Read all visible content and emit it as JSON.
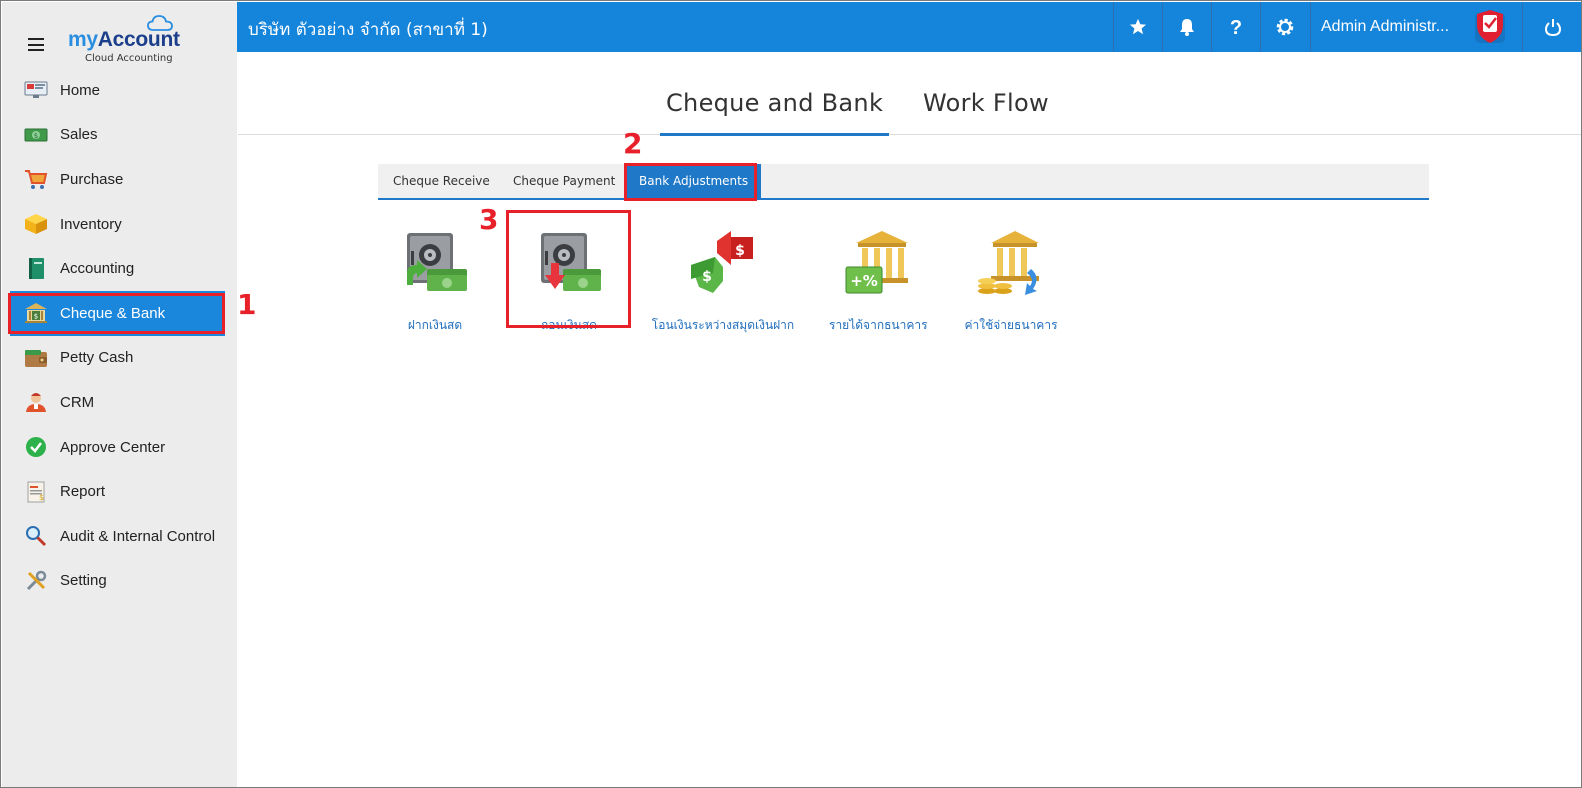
{
  "app": {
    "brand_my": "my",
    "brand_account": "Account",
    "brand_sub": "Cloud Accounting"
  },
  "sidebar": {
    "items": [
      {
        "label": "Home",
        "icon": "home-monitor-icon"
      },
      {
        "label": "Sales",
        "icon": "cash-icon"
      },
      {
        "label": "Purchase",
        "icon": "cart-icon"
      },
      {
        "label": "Inventory",
        "icon": "box-icon"
      },
      {
        "label": "Accounting",
        "icon": "book-icon"
      },
      {
        "label": "Cheque & Bank",
        "icon": "bank-icon"
      },
      {
        "label": "Petty Cash",
        "icon": "wallet-icon"
      },
      {
        "label": "CRM",
        "icon": "people-icon"
      },
      {
        "label": "Approve Center",
        "icon": "check-circle-icon"
      },
      {
        "label": "Report",
        "icon": "report-icon"
      },
      {
        "label": "Audit & Internal Control",
        "icon": "magnifier-icon"
      },
      {
        "label": "Setting",
        "icon": "tools-icon"
      }
    ],
    "active_index": 5
  },
  "topbar": {
    "company": "บริษัท ตัวอย่าง จำกัด (สาขาที่ 1)",
    "user": "Admin Administr...",
    "icons": [
      "star-icon",
      "bell-icon",
      "help-icon",
      "gear-icon",
      "shield-check-icon",
      "power-icon"
    ],
    "background": "#1584db"
  },
  "main_tabs": [
    {
      "label": "Cheque and Bank",
      "active": true
    },
    {
      "label": "Work Flow",
      "active": false
    }
  ],
  "sub_tabs": [
    {
      "label": "Cheque Receive",
      "active": false
    },
    {
      "label": "Cheque Payment",
      "active": false
    },
    {
      "label": "Bank Adjustments",
      "active": true
    }
  ],
  "tiles": [
    {
      "label": "ฝากเงินสด",
      "icon": "safe-deposit-icon"
    },
    {
      "label": "ถอนเงินสด",
      "icon": "safe-withdraw-icon"
    },
    {
      "label": "โอนเงินระหว่างสมุดเงินฝาก",
      "icon": "money-transfer-icon"
    },
    {
      "label": "รายได้จากธนาคาร",
      "icon": "bank-income-icon"
    },
    {
      "label": "ค่าใช้จ่ายธนาคาร",
      "icon": "bank-expense-icon"
    }
  ],
  "annotations": {
    "n1": "1",
    "n2": "2",
    "n3": "3",
    "color": "#e8202a"
  }
}
